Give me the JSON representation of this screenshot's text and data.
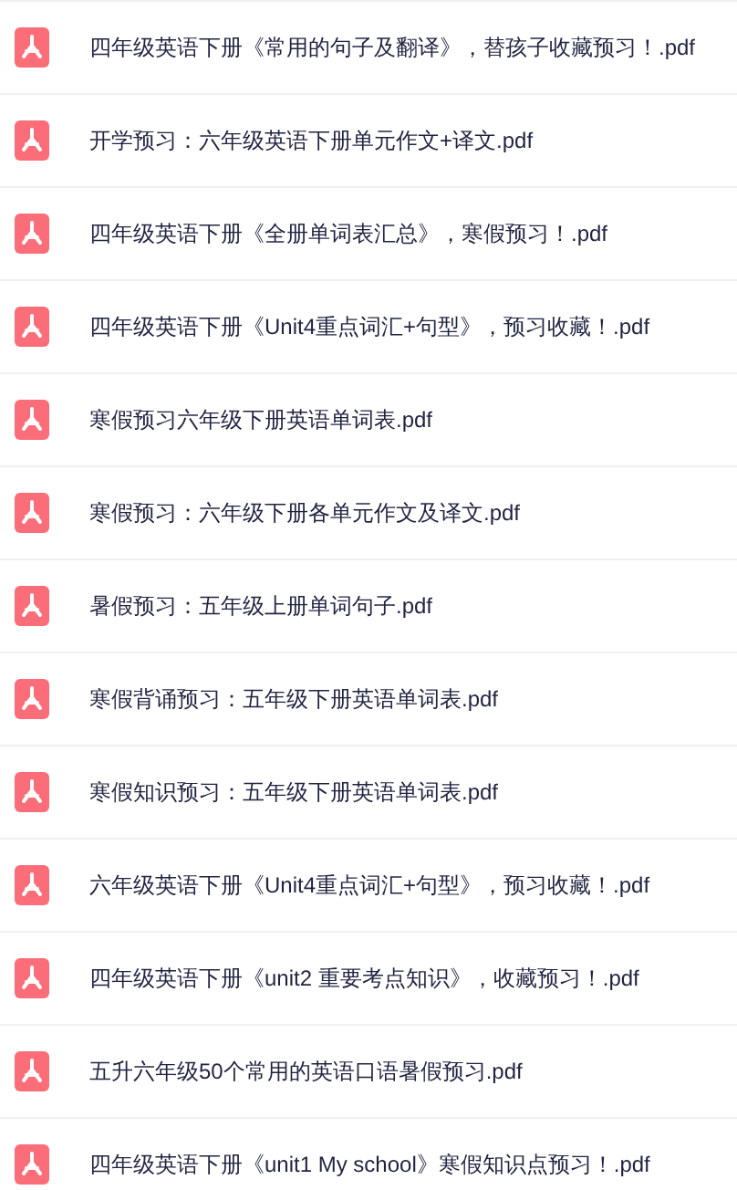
{
  "files": [
    {
      "name": "四年级英语下册《常用的句子及翻译》，替孩子收藏预习！.pdf"
    },
    {
      "name": "开学预习：六年级英语下册单元作文+译文.pdf"
    },
    {
      "name": "四年级英语下册《全册单词表汇总》，寒假预习！.pdf"
    },
    {
      "name": "四年级英语下册《Unit4重点词汇+句型》，预习收藏！.pdf"
    },
    {
      "name": "寒假预习六年级下册英语单词表.pdf"
    },
    {
      "name": "寒假预习：六年级下册各单元作文及译文.pdf"
    },
    {
      "name": "暑假预习：五年级上册单词句子.pdf"
    },
    {
      "name": "寒假背诵预习：五年级下册英语单词表.pdf"
    },
    {
      "name": "寒假知识预习：五年级下册英语单词表.pdf"
    },
    {
      "name": "六年级英语下册《Unit4重点词汇+句型》，预习收藏！.pdf"
    },
    {
      "name": "四年级英语下册《unit2 重要考点知识》，收藏预习！.pdf"
    },
    {
      "name": "五升六年级50个常用的英语口语暑假预习.pdf"
    },
    {
      "name": "四年级英语下册《unit1 My school》寒假知识点预习！.pdf"
    }
  ]
}
